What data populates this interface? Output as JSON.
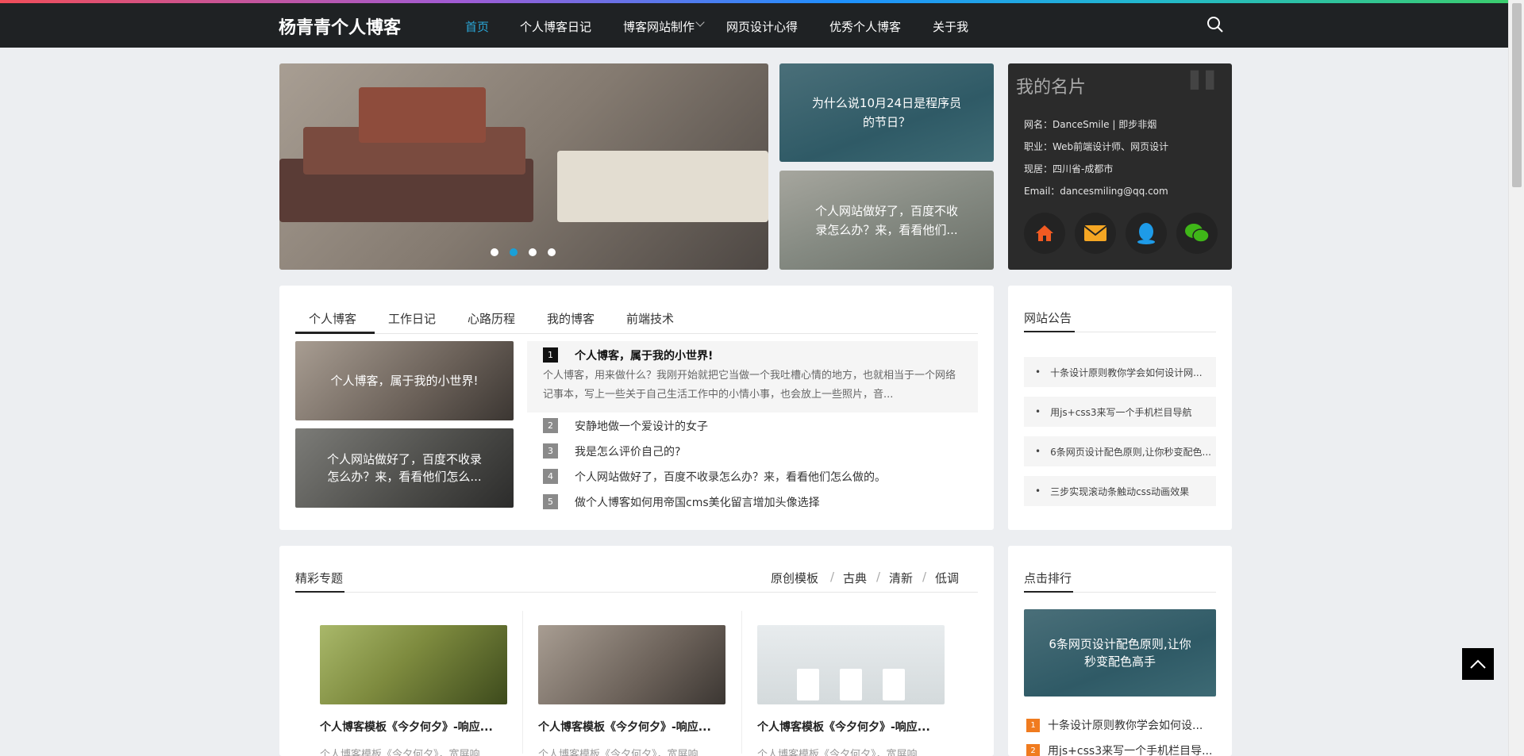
{
  "site": {
    "logo": "杨青青个人博客"
  },
  "nav": {
    "items": [
      {
        "label": "首页"
      },
      {
        "label": "个人博客日记"
      },
      {
        "label": "博客网站制作"
      },
      {
        "label": "网页设计心得"
      },
      {
        "label": "优秀个人博客"
      },
      {
        "label": "关于我"
      }
    ]
  },
  "banner": {
    "slides": 4,
    "active_slide": 2
  },
  "side_cards": [
    {
      "title": "为什么说10月24日是程序员的节日？"
    },
    {
      "title": "个人网站做好了，百度不收录怎么办？来，看看他们..."
    }
  ],
  "profile": {
    "title": "我的名片",
    "lines": [
      "网名：DanceSmile | 即步非烟",
      "职业：Web前端设计师、网页设计",
      "现居：四川省-成都市",
      "Email：dancesmiling@qq.com"
    ]
  },
  "tabs": {
    "items": [
      {
        "label": "个人博客"
      },
      {
        "label": "工作日记"
      },
      {
        "label": "心路历程"
      },
      {
        "label": "我的博客"
      },
      {
        "label": "前端技术"
      }
    ],
    "thumbs": [
      {
        "title": "个人博客，属于我的小世界!"
      },
      {
        "title": "个人网站做好了，百度不收录怎么办？来，看看他们怎么..."
      }
    ],
    "featured": {
      "num": "1",
      "title": "个人博客，属于我的小世界!",
      "excerpt": "个人博客，用来做什么？我刚开始就把它当做一个我吐槽心情的地方，也就相当于一个网络记事本，写上一些关于自己生活工作中的小情小事，也会放上一些照片，音..."
    },
    "list": [
      {
        "num": "2",
        "title": "安静地做一个爱设计的女子"
      },
      {
        "num": "3",
        "title": "我是怎么评价自己的?"
      },
      {
        "num": "4",
        "title": "个人网站做好了，百度不收录怎么办？来，看看他们怎么做的。"
      },
      {
        "num": "5",
        "title": "做个人博客如何用帝国cms美化留言增加头像选择"
      }
    ]
  },
  "notice": {
    "title": "网站公告",
    "items": [
      "十条设计原则教你学会如何设计网...",
      "用js+css3来写一个手机栏目导航",
      "6条网页设计配色原则,让你秒变配色...",
      "三步实现滚动条触动css动画效果"
    ]
  },
  "topics": {
    "title": "精彩专题",
    "filters": [
      "原创模板",
      "古典",
      "清新",
      "低调"
    ],
    "cards": [
      {
        "title": "个人博客模板《今夕何夕》-响应...",
        "sub": "个人博客模板《今夕何夕》，宽屏响"
      },
      {
        "title": "个人博客模板《今夕何夕》-响应...",
        "sub": "个人博客模板《今夕何夕》，宽屏响"
      },
      {
        "title": "个人博客模板《今夕何夕》-响应...",
        "sub": "个人博客模板《今夕何夕》，宽屏响"
      }
    ]
  },
  "ranking": {
    "title": "点击排行",
    "featured": "6条网页设计配色原则,让你秒变配色高手",
    "items": [
      {
        "num": "1",
        "title": "十条设计原则教你学会如何设..."
      },
      {
        "num": "2",
        "title": "用js+css3来写一个手机栏目导..."
      }
    ]
  },
  "colors": {
    "accent": "#2aa6d6",
    "nav_bg": "#1f2224",
    "rank": "#f07b1f"
  }
}
